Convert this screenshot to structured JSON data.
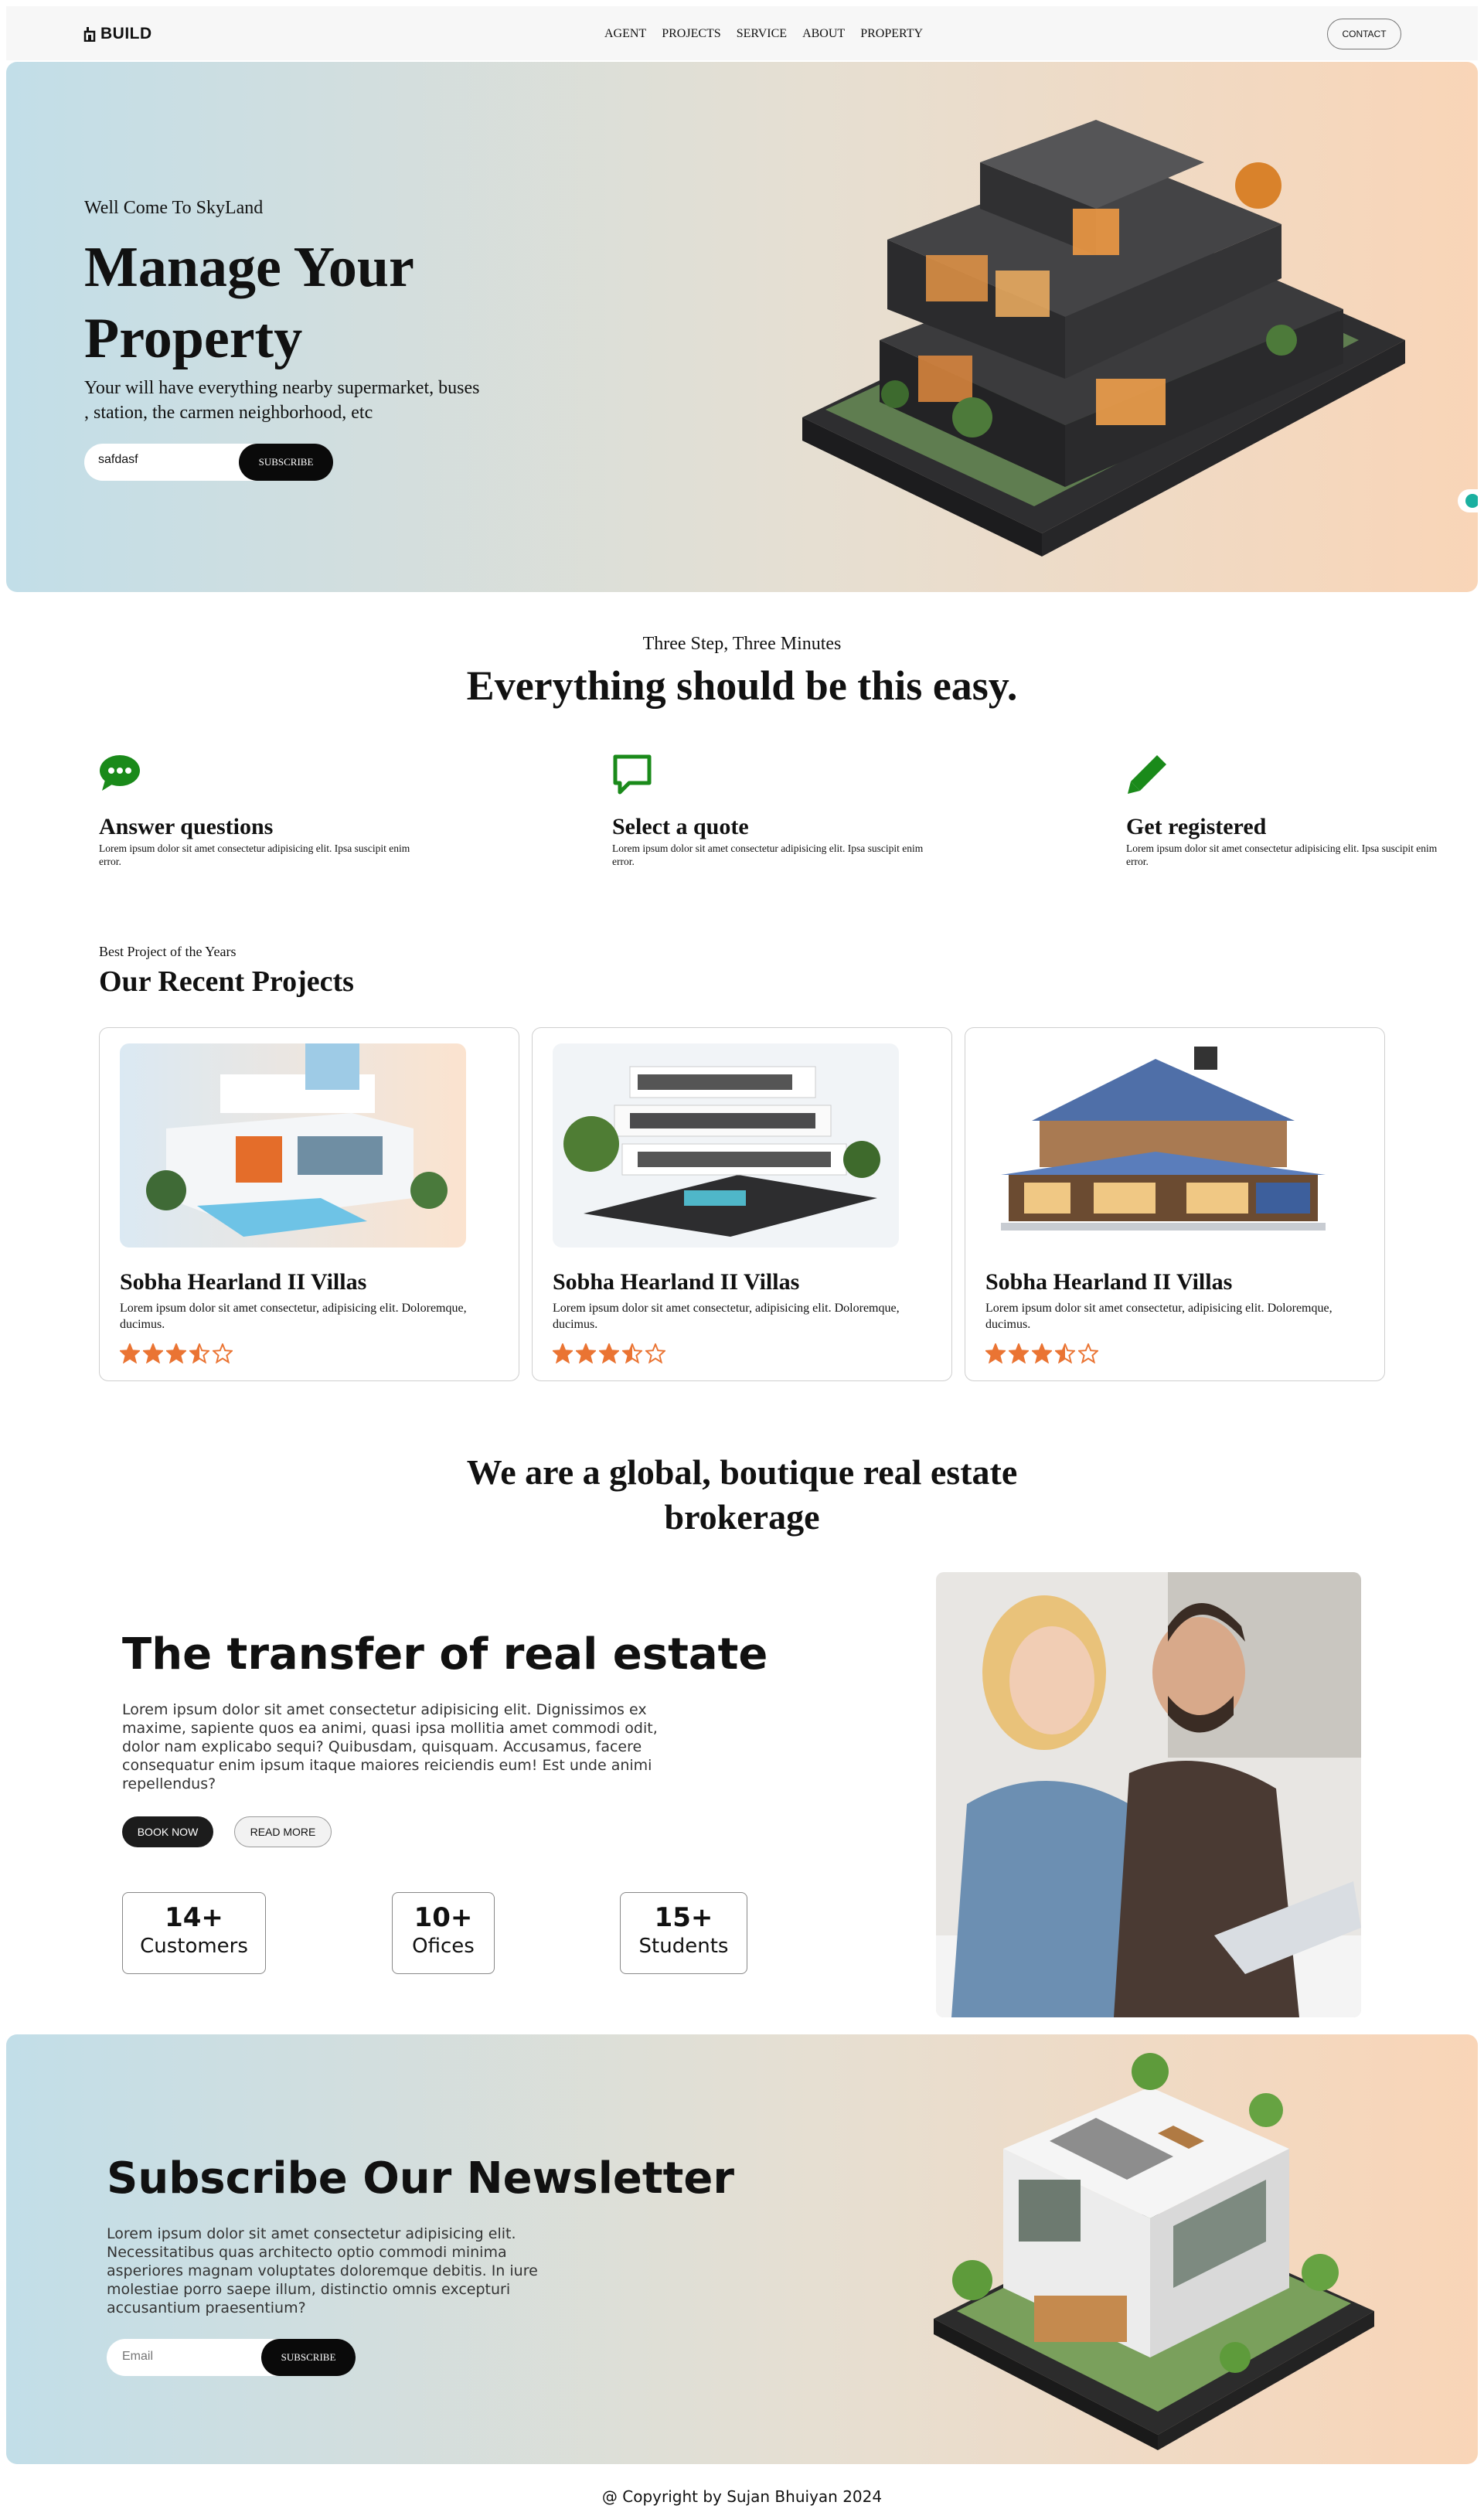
{
  "nav": {
    "logo": "BUILD",
    "links": [
      "AGENT",
      "PROJECTS",
      "SERVICE",
      "ABOUT",
      "PROPERTY"
    ],
    "contact": "CONTACT"
  },
  "hero": {
    "subtitle": "Well Come To SkyLand",
    "title": "Manage Your Property",
    "description": "Your will have everything nearby supermarket, buses , station, the carmen neighborhood, etc",
    "input_value": "safdasf",
    "subscribe": "SUBSCRIBE"
  },
  "steps": {
    "subtitle": "Three Step, Three Minutes",
    "title": "Everything should be this easy.",
    "items": [
      {
        "icon": "chat-bubble-icon",
        "title": "Answer questions",
        "text": "Lorem ipsum dolor sit amet consectetur adipisicing elit. Ipsa suscipit enim error."
      },
      {
        "icon": "message-square-icon",
        "title": "Select a quote",
        "text": "Lorem ipsum dolor sit amet consectetur adipisicing elit. Ipsa suscipit enim error."
      },
      {
        "icon": "pencil-icon",
        "title": "Get registered",
        "text": "Lorem ipsum dolor sit amet consectetur adipisicing elit. Ipsa suscipit enim error."
      }
    ],
    "icon_color": "#1a8a1a"
  },
  "projects": {
    "subtitle": "Best Project of the Years",
    "title": "Our Recent Projects",
    "cards": [
      {
        "title": "Sobha Hearland II Villas",
        "text": "Lorem ipsum dolor sit amet consectetur, adipisicing elit. Doloremque, ducimus.",
        "rating": 3.5
      },
      {
        "title": "Sobha Hearland II Villas",
        "text": "Lorem ipsum dolor sit amet consectetur, adipisicing elit. Doloremque, ducimus.",
        "rating": 3.5
      },
      {
        "title": "Sobha Hearland II Villas",
        "text": "Lorem ipsum dolor sit amet consectetur, adipisicing elit. Doloremque, ducimus.",
        "rating": 3.5
      }
    ],
    "star_color": "#ea7433"
  },
  "about": {
    "heading": "We are a global, boutique real estate brokerage",
    "title": "The transfer of real estate",
    "text": "Lorem ipsum dolor sit amet consectetur adipisicing elit. Dignissimos ex maxime, sapiente quos ea animi, quasi ipsa mollitia amet commodi odit, dolor nam explicabo sequi? Quibusdam, quisquam. Accusamus, facere consequatur enim ipsum itaque maiores reiciendis eum! Est unde animi repellendus?",
    "book_now": "BOOK NOW",
    "read_more": "READ MORE",
    "stats": [
      {
        "num": "14+",
        "label": "Customers"
      },
      {
        "num": "10+",
        "label": "Ofices"
      },
      {
        "num": "15+",
        "label": "Students"
      }
    ]
  },
  "newsletter": {
    "title": "Subscribe Our Newsletter",
    "text": "Lorem ipsum dolor sit amet consectetur adipisicing elit. Necessitatibus quas architecto optio commodi minima asperiores magnam voluptates doloremque debitis. In iure molestiae porro saepe illum, distinctio omnis excepturi accusantium praesentium?",
    "placeholder": "Email",
    "subscribe": "SUBSCRIBE"
  },
  "footer": {
    "copyright": "@ Copyright by Sujan Bhuiyan 2024"
  }
}
